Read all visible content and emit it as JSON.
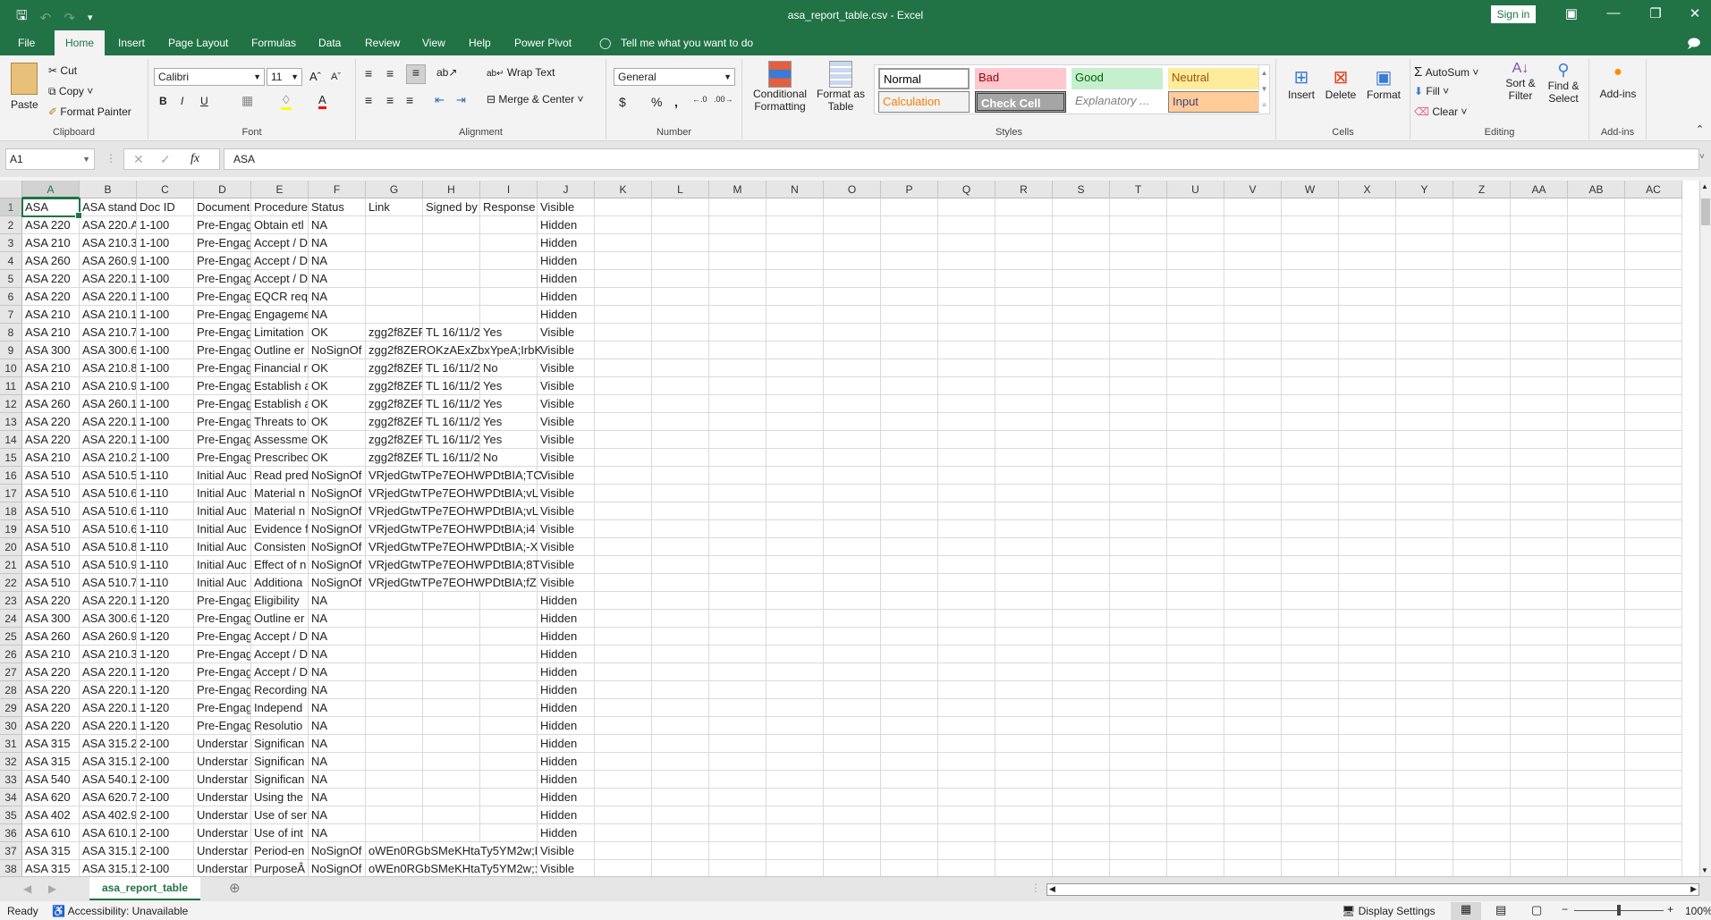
{
  "window": {
    "title": "asa_report_table.csv  -  Excel",
    "sign_in": "Sign in"
  },
  "ribbon_tabs": [
    "File",
    "Home",
    "Insert",
    "Page Layout",
    "Formulas",
    "Data",
    "Review",
    "View",
    "Help",
    "Power Pivot"
  ],
  "active_tab": "Home",
  "tell_me": "Tell me what you want to do",
  "clipboard": {
    "paste": "Paste",
    "cut": "Cut",
    "copy": "Copy",
    "format_painter": "Format Painter",
    "label": "Clipboard"
  },
  "font": {
    "name": "Calibri",
    "size": "11",
    "bold": "B",
    "italic": "I",
    "underline": "U",
    "label": "Font"
  },
  "alignment": {
    "wrap_text": "Wrap Text",
    "merge_center": "Merge & Center",
    "label": "Alignment"
  },
  "number": {
    "format": "General",
    "currency": "$",
    "percent": "%",
    "comma": ",",
    "label": "Number"
  },
  "styles": {
    "conditional_formatting": [
      "Conditional",
      "Formatting"
    ],
    "format_as_table": [
      "Format as",
      "Table"
    ],
    "cells": [
      {
        "name": "Normal",
        "bg": "#ffffff",
        "fg": "#000000"
      },
      {
        "name": "Bad",
        "bg": "#ffc7ce",
        "fg": "#9c0006"
      },
      {
        "name": "Good",
        "bg": "#c6efce",
        "fg": "#006100"
      },
      {
        "name": "Neutral",
        "bg": "#ffeb9c",
        "fg": "#9c5700"
      },
      {
        "name": "Calculation",
        "bg": "#f2f2f2",
        "fg": "#fa7d00"
      },
      {
        "name": "Check Cell",
        "bg": "#a5a5a5",
        "fg": "#ffffff"
      },
      {
        "name": "Explanatory ...",
        "bg": "#ffffff",
        "fg": "#7f7f7f"
      },
      {
        "name": "Input",
        "bg": "#ffcc99",
        "fg": "#3f3f76"
      }
    ],
    "label": "Styles"
  },
  "cells_group": {
    "insert": "Insert",
    "delete": "Delete",
    "format": "Format",
    "label": "Cells"
  },
  "editing": {
    "autosum": "AutoSum",
    "fill": "Fill",
    "clear": "Clear",
    "sort_filter": [
      "Sort &",
      "Filter"
    ],
    "find_select": [
      "Find &",
      "Select"
    ],
    "label": "Editing"
  },
  "addins": {
    "addins": "Add-ins",
    "label": "Add-ins"
  },
  "formula_bar": {
    "name_box": "A1",
    "fx": "fx",
    "value": "ASA"
  },
  "columns": [
    "A",
    "B",
    "C",
    "D",
    "E",
    "F",
    "G",
    "H",
    "I",
    "J",
    "K",
    "L",
    "M",
    "N",
    "O",
    "P",
    "Q",
    "R",
    "S",
    "T",
    "U",
    "V",
    "W",
    "X",
    "Y",
    "Z",
    "AA",
    "AB",
    "AC"
  ],
  "rows": [
    [
      "ASA",
      "ASA stand",
      "Doc ID",
      "Document",
      "Procedure",
      "Status",
      "Link",
      "Signed by",
      "Response",
      "Visible"
    ],
    [
      "ASA 220",
      "ASA 220.A",
      "1-100",
      "Pre-Engag",
      "Obtain etl",
      "NA",
      "",
      "",
      "",
      "Hidden"
    ],
    [
      "ASA 210",
      "ASA 210.3",
      "1-100",
      "Pre-Engag",
      "Accept / D",
      "NA",
      "",
      "",
      "",
      "Hidden"
    ],
    [
      "ASA 260",
      "ASA 260.9",
      "1-100",
      "Pre-Engag",
      "Accept / D",
      "NA",
      "",
      "",
      "",
      "Hidden"
    ],
    [
      "ASA 220",
      "ASA 220.1",
      "1-100",
      "Pre-Engag",
      "Accept / D",
      "NA",
      "",
      "",
      "",
      "Hidden"
    ],
    [
      "ASA 220",
      "ASA 220.1",
      "1-100",
      "Pre-Engag",
      "EQCR requ",
      "NA",
      "",
      "",
      "",
      "Hidden"
    ],
    [
      "ASA 210",
      "ASA 210.1",
      "1-100",
      "Pre-Engag",
      "Engageme",
      "NA",
      "",
      "",
      "",
      "Hidden"
    ],
    [
      "ASA 210",
      "ASA 210.7",
      "1-100",
      "Pre-Engag",
      "Limitation",
      "OK",
      "zgg2f8ZER",
      "TL 16/11/2",
      "Yes",
      "Visible"
    ],
    [
      "ASA 300",
      "ASA 300.6",
      "1-100",
      "Pre-Engag",
      "Outline er",
      "NoSignOf",
      "zgg2f8ZEROKzAExZbxYpeA;IrbK",
      "",
      "",
      "Visible"
    ],
    [
      "ASA 210",
      "ASA 210.8",
      "1-100",
      "Pre-Engag",
      "Financial r",
      "OK",
      "zgg2f8ZER",
      "TL 16/11/2",
      "No",
      "Visible"
    ],
    [
      "ASA 210",
      "ASA 210.9",
      "1-100",
      "Pre-Engag",
      "Establish a",
      "OK",
      "zgg2f8ZER",
      "TL 16/11/2",
      "Yes",
      "Visible"
    ],
    [
      "ASA 260",
      "ASA 260.1",
      "1-100",
      "Pre-Engag",
      "Establish a",
      "OK",
      "zgg2f8ZER",
      "TL 16/11/2",
      "Yes",
      "Visible"
    ],
    [
      "ASA 220",
      "ASA 220.1",
      "1-100",
      "Pre-Engag",
      "Threats to",
      "OK",
      "zgg2f8ZER",
      "TL 16/11/2",
      "Yes",
      "Visible"
    ],
    [
      "ASA 220",
      "ASA 220.1",
      "1-100",
      "Pre-Engag",
      "Assessme",
      "OK",
      "zgg2f8ZER",
      "TL 16/11/2",
      "Yes",
      "Visible"
    ],
    [
      "ASA 210",
      "ASA 210.2",
      "1-100",
      "Pre-Engag",
      "Prescribed",
      "OK",
      "zgg2f8ZER",
      "TL 16/11/2",
      "No",
      "Visible"
    ],
    [
      "ASA 510",
      "ASA 510.5",
      "1-110",
      "Initial Auc",
      "Read pred",
      "NoSignOf",
      "VRjedGtwTPe7EOHWPDtBIA;TC",
      "",
      "",
      "Visible"
    ],
    [
      "ASA 510",
      "ASA 510.6",
      "1-110",
      "Initial Auc",
      "Material n",
      "NoSignOf",
      "VRjedGtwTPe7EOHWPDtBIA;vL",
      "",
      "",
      "Visible"
    ],
    [
      "ASA 510",
      "ASA 510.6",
      "1-110",
      "Initial Auc",
      "Material n",
      "NoSignOf",
      "VRjedGtwTPe7EOHWPDtBIA;vL",
      "",
      "",
      "Visible"
    ],
    [
      "ASA 510",
      "ASA 510.6",
      "1-110",
      "Initial Auc",
      "Evidence f",
      "NoSignOf",
      "VRjedGtwTPe7EOHWPDtBIA;i4",
      "",
      "",
      "Visible"
    ],
    [
      "ASA 510",
      "ASA 510.8",
      "1-110",
      "Initial Auc",
      "Consisten",
      "NoSignOf",
      "VRjedGtwTPe7EOHWPDtBIA;-X",
      "",
      "",
      "Visible"
    ],
    [
      "ASA 510",
      "ASA 510.9",
      "1-110",
      "Initial Auc",
      "Effect of n",
      "NoSignOf",
      "VRjedGtwTPe7EOHWPDtBIA;8T",
      "",
      "",
      "Visible"
    ],
    [
      "ASA 510",
      "ASA 510.7",
      "1-110",
      "Initial Auc",
      "Additiona",
      "NoSignOf",
      "VRjedGtwTPe7EOHWPDtBIA;fZ",
      "",
      "",
      "Visible"
    ],
    [
      "ASA 220",
      "ASA 220.1",
      "1-120",
      "Pre-Engag",
      "Eligibility",
      "NA",
      "",
      "",
      "",
      "Hidden"
    ],
    [
      "ASA 300",
      "ASA 300.6",
      "1-120",
      "Pre-Engag",
      "Outline er",
      "NA",
      "",
      "",
      "",
      "Hidden"
    ],
    [
      "ASA 260",
      "ASA 260.9",
      "1-120",
      "Pre-Engag",
      "Accept / D",
      "NA",
      "",
      "",
      "",
      "Hidden"
    ],
    [
      "ASA 210",
      "ASA 210.3",
      "1-120",
      "Pre-Engag",
      "Accept / D",
      "NA",
      "",
      "",
      "",
      "Hidden"
    ],
    [
      "ASA 220",
      "ASA 220.1",
      "1-120",
      "Pre-Engag",
      "Accept / D",
      "NA",
      "",
      "",
      "",
      "Hidden"
    ],
    [
      "ASA 220",
      "ASA 220.1",
      "1-120",
      "Pre-Engag",
      "Recording",
      "NA",
      "",
      "",
      "",
      "Hidden"
    ],
    [
      "ASA 220",
      "ASA 220.1",
      "1-120",
      "Pre-Engag",
      "Independ",
      "NA",
      "",
      "",
      "",
      "Hidden"
    ],
    [
      "ASA 220",
      "ASA 220.1",
      "1-120",
      "Pre-Engag",
      "Resolutio",
      "NA",
      "",
      "",
      "",
      "Hidden"
    ],
    [
      "ASA 315",
      "ASA 315.2",
      "2-100",
      "Understar",
      "Significan",
      "NA",
      "",
      "",
      "",
      "Hidden"
    ],
    [
      "ASA 315",
      "ASA 315.1",
      "2-100",
      "Understar",
      "Significan",
      "NA",
      "",
      "",
      "",
      "Hidden"
    ],
    [
      "ASA 540",
      "ASA 540.1",
      "2-100",
      "Understar",
      "Significan",
      "NA",
      "",
      "",
      "",
      "Hidden"
    ],
    [
      "ASA 620",
      "ASA 620.7",
      "2-100",
      "Understar",
      "Using the",
      "NA",
      "",
      "",
      "",
      "Hidden"
    ],
    [
      "ASA 402",
      "ASA 402.9",
      "2-100",
      "Understar",
      "Use of ser",
      "NA",
      "",
      "",
      "",
      "Hidden"
    ],
    [
      "ASA 610",
      "ASA 610.1",
      "2-100",
      "Understar",
      "Use of int",
      "NA",
      "",
      "",
      "",
      "Hidden"
    ],
    [
      "ASA 315",
      "ASA 315.1",
      "2-100",
      "Understar",
      "Period-en",
      "NoSignOf",
      "oWEn0RGbSMeKHtaTy5YM2w;I",
      "",
      "",
      "Visible"
    ],
    [
      "ASA 315",
      "ASA 315.1",
      "2-100",
      "Understar",
      "PurposeÂ",
      "NoSignOf",
      "oWEn0RGbSMeKHtaTy5YM2w;:",
      "",
      "",
      "Visible"
    ]
  ],
  "sheet_tabs": [
    "asa_report_table"
  ],
  "status": {
    "ready": "Ready",
    "accessibility": "Accessibility: Unavailable",
    "display_settings": "Display Settings",
    "zoom": "100%"
  },
  "accent_color": "#217346"
}
